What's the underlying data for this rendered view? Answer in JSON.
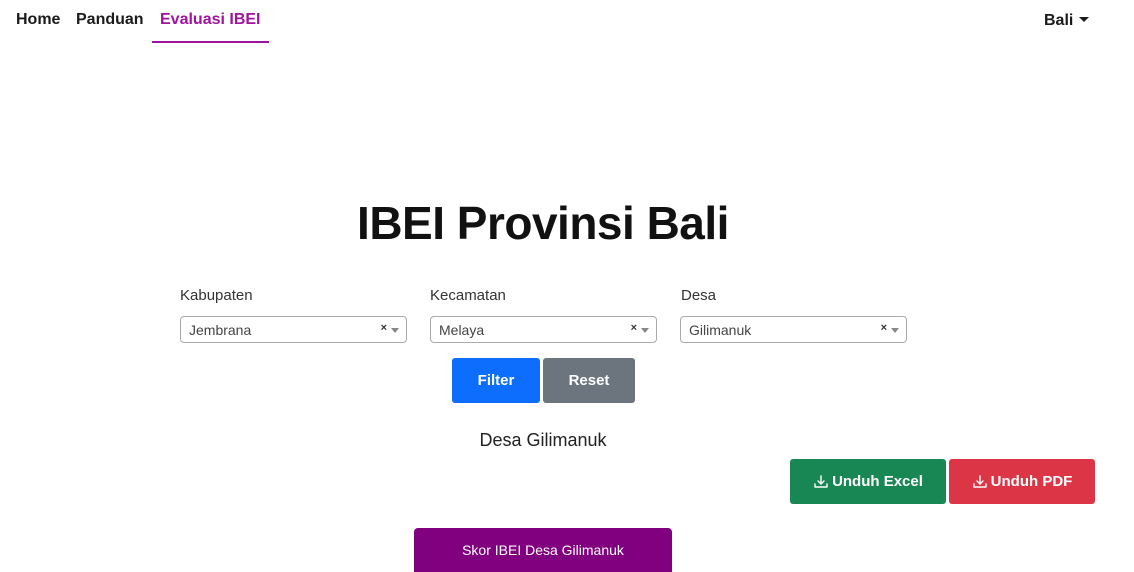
{
  "nav": {
    "home": "Home",
    "guide": "Panduan",
    "evaluation": "Evaluasi IBEI",
    "region": "Bali"
  },
  "title": "IBEI Provinsi Bali",
  "filters": {
    "kabupaten": {
      "label": "Kabupaten",
      "value": "Jembrana",
      "clear": "×"
    },
    "kecamatan": {
      "label": "Kecamatan",
      "value": "Melaya",
      "clear": "×"
    },
    "desa": {
      "label": "Desa",
      "value": "Gilimanuk",
      "clear": "×"
    }
  },
  "buttons": {
    "filter": "Filter",
    "reset": "Reset",
    "excel": "Unduh Excel",
    "pdf": "Unduh PDF",
    "score": "Skor IBEI Desa Gilimanuk"
  },
  "desa_heading": "Desa Gilimanuk",
  "colors": {
    "accent": "#a0139f",
    "filter": "#0d6efd",
    "reset": "#6c757d",
    "excel": "#198754",
    "pdf": "#dc3545",
    "score": "#800080"
  }
}
